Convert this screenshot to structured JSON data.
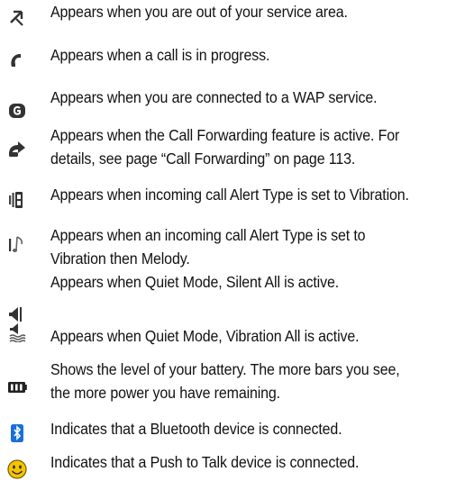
{
  "rows": [
    {
      "icon": "out-of-service-icon",
      "lines": [
        "Appears when you are out of your service area."
      ]
    },
    {
      "icon": "call-in-progress-icon",
      "lines": [
        "Appears when a call is in progress."
      ]
    },
    {
      "icon": "wap-service-icon",
      "lines": [
        "Appears when you are connected to a WAP service."
      ]
    },
    {
      "icon": "call-forwarding-icon",
      "lines": [
        "Appears when the Call Forwarding feature is active. For",
        "details, see page “Call Forwarding” on page 113."
      ]
    },
    {
      "icon": "vibration-alert-icon",
      "lines": [
        "Appears when incoming call Alert Type is set to Vibration."
      ]
    },
    {
      "icon": "vibration-then-melody-icon",
      "lines": [
        "Appears when an incoming call Alert Type is set to",
        "Vibration then Melody."
      ]
    },
    {
      "icon": "silent-all-icon",
      "lines": [
        "Appears when Quiet Mode, Silent All is active."
      ]
    },
    {
      "icon": "vibration-all-icon",
      "lines": [
        "Appears when Quiet Mode, Vibration All is active."
      ]
    },
    {
      "icon": "battery-level-icon",
      "lines": [
        "Shows the level of your battery. The more bars you see,",
        "the more power you have remaining."
      ]
    },
    {
      "icon": "bluetooth-icon",
      "lines": [
        "Indicates that a Bluetooth device is connected."
      ]
    },
    {
      "icon": "push-to-talk-icon",
      "lines": [
        "Indicates that a Push to Talk device is connected."
      ]
    }
  ]
}
